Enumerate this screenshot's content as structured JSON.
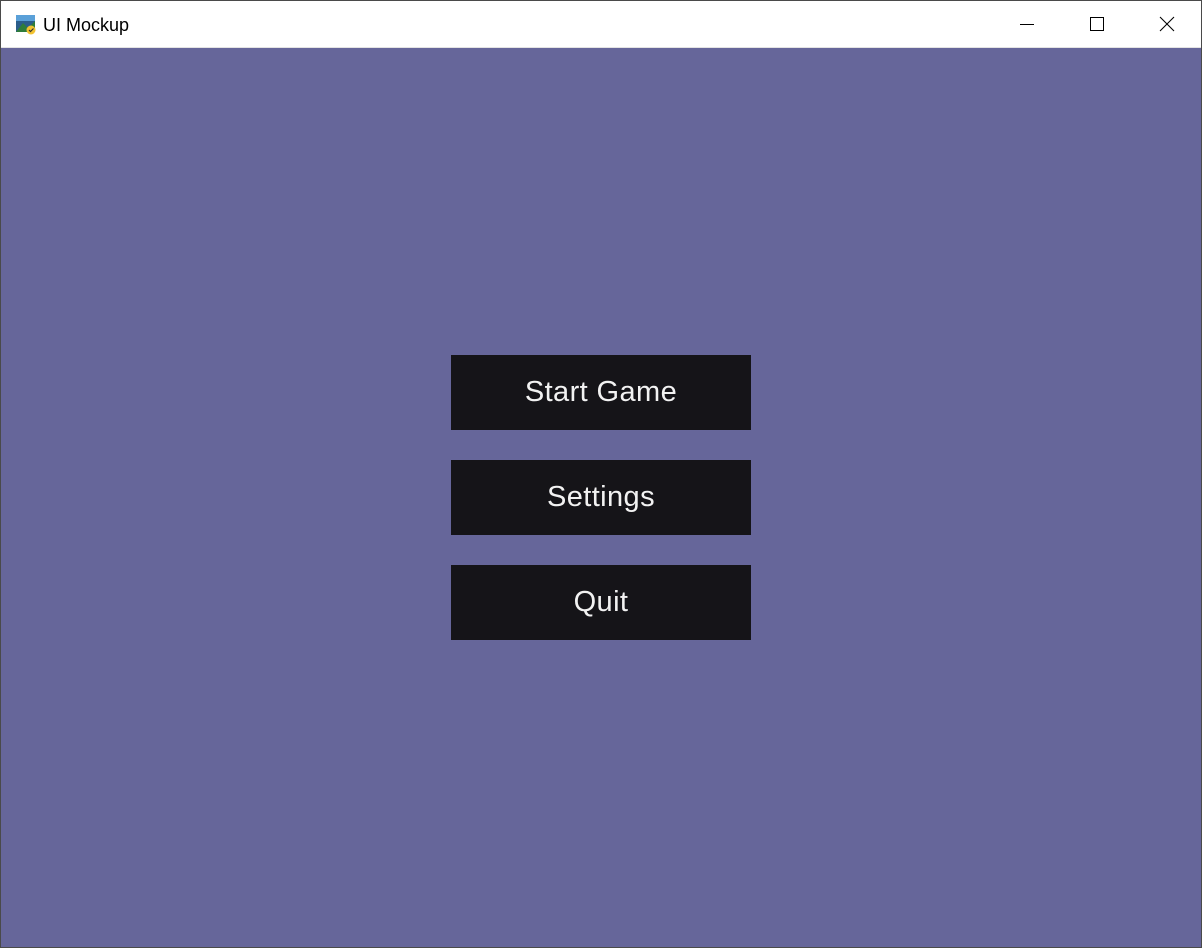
{
  "window": {
    "title": "UI Mockup",
    "app_icon": "app-icon",
    "controls": {
      "minimize_icon": "minimize-icon",
      "maximize_icon": "maximize-icon",
      "close_icon": "close-icon"
    }
  },
  "menu": {
    "start_label": "Start Game",
    "settings_label": "Settings",
    "quit_label": "Quit"
  },
  "colors": {
    "background": "#66669a",
    "button": "#151418",
    "button_text": "#f2f2f2",
    "titlebar": "#ffffff"
  }
}
